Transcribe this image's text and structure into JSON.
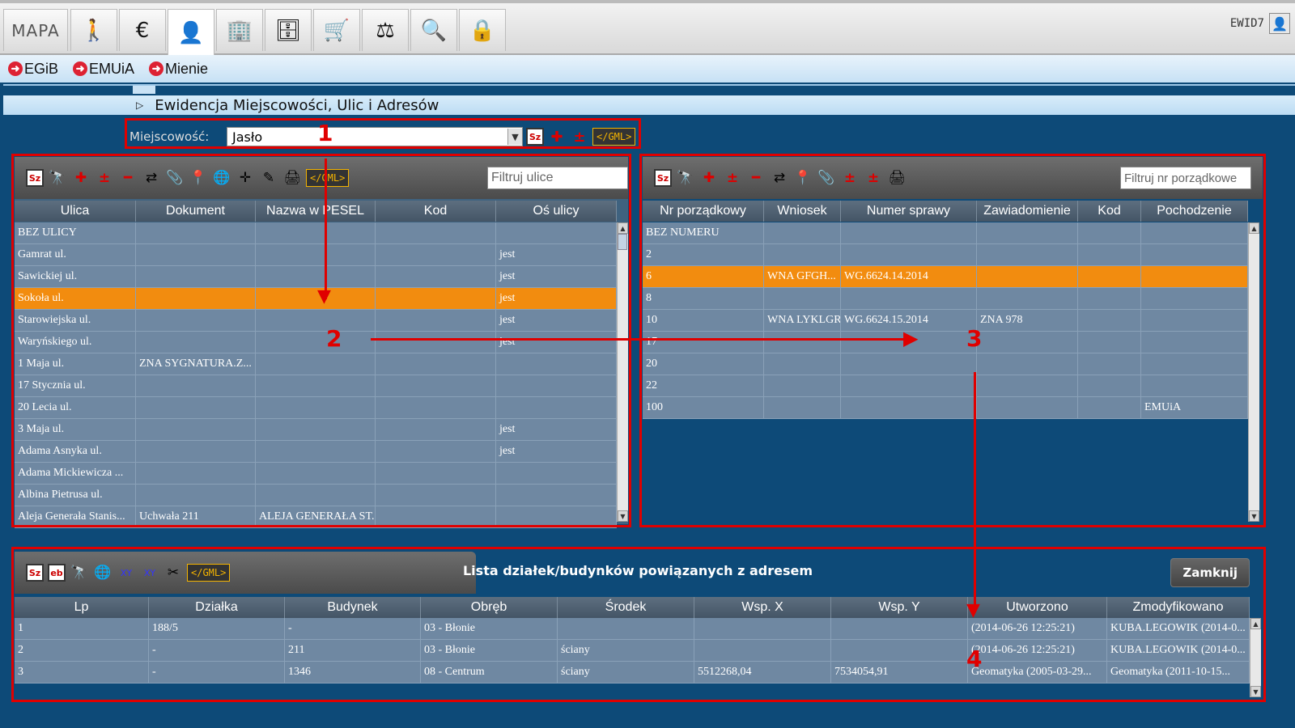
{
  "topbar": {
    "tabs": [
      {
        "label": "MAPA",
        "icon": "map-icon"
      },
      {
        "label": "",
        "icon": "surveyor-icon",
        "glyph": "⚲"
      },
      {
        "label": "",
        "icon": "euro-icon",
        "glyph": "€"
      },
      {
        "label": "",
        "icon": "person-icon",
        "glyph": "👤"
      },
      {
        "label": "",
        "icon": "buildings-icon",
        "glyph": "🏢"
      },
      {
        "label": "",
        "icon": "cabinet-icon",
        "glyph": "🗄"
      },
      {
        "label": "",
        "icon": "cart-icon",
        "glyph": "🛒"
      },
      {
        "label": "",
        "icon": "gavel-icon",
        "glyph": "⚖"
      },
      {
        "label": "",
        "icon": "search-icon",
        "glyph": "🔍"
      },
      {
        "label": "",
        "icon": "lock-icon",
        "glyph": "🔒"
      }
    ],
    "user": "EWID7"
  },
  "links": [
    "EGiB",
    "EMUiA",
    "Mienie"
  ],
  "section_title": "Ewidencja Miejscowości, Ulic i Adresów",
  "miejscowosc": {
    "label": "Miejscowość:",
    "value": "Jasło"
  },
  "gml_label": "</GML>",
  "sz_label": "Sz",
  "streets": {
    "filter_placeholder": "Filtruj ulice",
    "headers": [
      "Ulica",
      "Dokument",
      "Nazwa w PESEL",
      "Kod",
      "Oś ulicy"
    ],
    "rows": [
      [
        "BEZ ULICY",
        "",
        "",
        "",
        ""
      ],
      [
        "Gamrat ul.",
        "",
        "",
        "",
        "jest"
      ],
      [
        "Sawickiej ul.",
        "",
        "",
        "",
        "jest"
      ],
      [
        "Sokoła ul.",
        "",
        "",
        "",
        "jest"
      ],
      [
        "Starowiejska ul.",
        "",
        "",
        "",
        "jest"
      ],
      [
        "Waryńskiego ul.",
        "",
        "",
        "",
        "jest"
      ],
      [
        "1 Maja ul.",
        "ZNA SYGNATURA.Z...",
        "",
        "",
        ""
      ],
      [
        "17 Stycznia ul.",
        "",
        "",
        "",
        ""
      ],
      [
        "20 Lecia ul.",
        "",
        "",
        "",
        ""
      ],
      [
        "3 Maja ul.",
        "",
        "",
        "",
        "jest"
      ],
      [
        "Adama Asnyka ul.",
        "",
        "",
        "",
        "jest"
      ],
      [
        "Adama Mickiewicza ...",
        "",
        "",
        "",
        ""
      ],
      [
        "Albina Pietrusa ul.",
        "",
        "",
        "",
        ""
      ],
      [
        "Aleja Generała Stanis...",
        "Uchwała 211",
        "ALEJA GENERAŁA ST...",
        "",
        ""
      ]
    ],
    "selected_index": 3
  },
  "numbers": {
    "filter_placeholder": "Filtruj nr porządkowe",
    "headers": [
      "Nr porządkowy",
      "Wniosek",
      "Numer sprawy",
      "Zawiadomienie",
      "Kod",
      "Pochodzenie"
    ],
    "rows": [
      [
        "BEZ NUMERU",
        "",
        "",
        "",
        "",
        ""
      ],
      [
        "2",
        "",
        "",
        "",
        "",
        ""
      ],
      [
        "6",
        "WNA GFGH...",
        "WG.6624.14.2014",
        "",
        "",
        ""
      ],
      [
        "8",
        "",
        "",
        "",
        "",
        ""
      ],
      [
        "10",
        "WNA LYKLGR",
        "WG.6624.15.2014",
        "ZNA 978",
        "",
        ""
      ],
      [
        "17",
        "",
        "",
        "",
        "",
        ""
      ],
      [
        "20",
        "",
        "",
        "",
        "",
        ""
      ],
      [
        "22",
        "",
        "",
        "",
        "",
        ""
      ],
      [
        "100",
        "",
        "",
        "",
        "",
        "EMUiA"
      ]
    ],
    "selected_index": 2
  },
  "parcels": {
    "title": "Lista działek/budynków powiązanych z adresem",
    "close_label": "Zamknij",
    "headers": [
      "Lp",
      "Działka",
      "Budynek",
      "Obręb",
      "Środek",
      "Wsp. X",
      "Wsp. Y",
      "Utworzono",
      "Zmodyfikowano"
    ],
    "rows": [
      [
        "1",
        "188/5",
        "-",
        "03 - Błonie",
        "",
        "",
        "",
        "(2014-06-26 12:25:21)",
        "KUBA.LEGOWIK (2014-0..."
      ],
      [
        "2",
        "-",
        "211",
        "03 - Błonie",
        "ściany",
        "",
        "",
        "(2014-06-26 12:25:21)",
        "KUBA.LEGOWIK (2014-0..."
      ],
      [
        "3",
        "-",
        "1346",
        "08 - Centrum",
        "ściany",
        "5512268,04",
        "7534054,91",
        "Geomatyka (2005-03-29...",
        "Geomatyka (2011-10-15..."
      ]
    ]
  },
  "annotations": [
    "1",
    "2",
    "3",
    "4"
  ],
  "colors": {
    "accent": "#f28c0f",
    "annotation": "#e00000",
    "row": "#6f88a2",
    "background": "#0d4a78"
  }
}
